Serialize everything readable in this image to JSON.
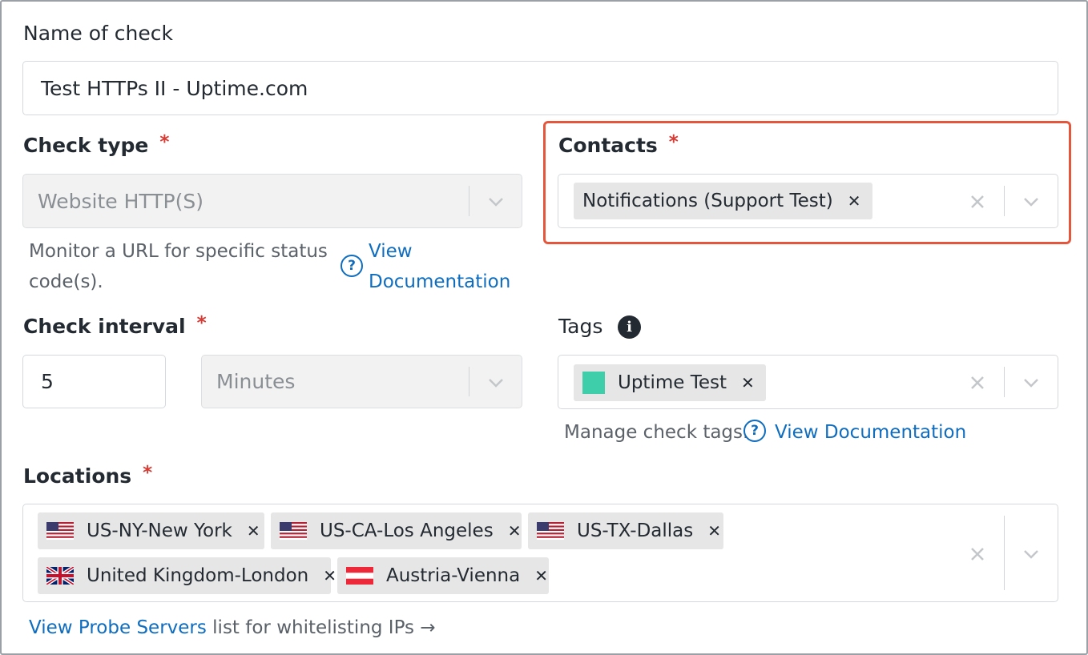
{
  "name_field": {
    "label": "Name of check",
    "value": "Test HTTPs II - Uptime.com"
  },
  "check_type": {
    "label": "Check type",
    "required_mark": "*",
    "value": "Website HTTP(S)",
    "help_text": "Monitor a URL for specific status code(s).",
    "doc_link": "View Documentation"
  },
  "contacts": {
    "label": "Contacts",
    "required_mark": "*",
    "chips": [
      {
        "label": "Notifications (Support Test)"
      }
    ]
  },
  "check_interval": {
    "label": "Check interval",
    "required_mark": "*",
    "value": "5",
    "unit": "Minutes"
  },
  "tags": {
    "label": "Tags",
    "chips": [
      {
        "label": "Uptime Test",
        "color": "#3ecfaa"
      }
    ],
    "help_text": "Manage check tags.",
    "doc_link": "View Documentation"
  },
  "locations": {
    "label": "Locations",
    "required_mark": "*",
    "chips": [
      {
        "label": "US-NY-New York",
        "flag": "us-flag-icon"
      },
      {
        "label": "US-CA-Los Angeles",
        "flag": "us-flag-icon"
      },
      {
        "label": "US-TX-Dallas",
        "flag": "us-flag-icon"
      },
      {
        "label": "United Kingdom-London",
        "flag": "uk-flag-icon"
      },
      {
        "label": "Austria-Vienna",
        "flag": "austria-flag-icon"
      }
    ]
  },
  "probe_servers": {
    "link": "View Probe Servers",
    "text": "list for whitelisting IPs →"
  },
  "colors": {
    "required": "#d63b34",
    "link": "#0f6dbf",
    "highlight": "#e4573d"
  }
}
